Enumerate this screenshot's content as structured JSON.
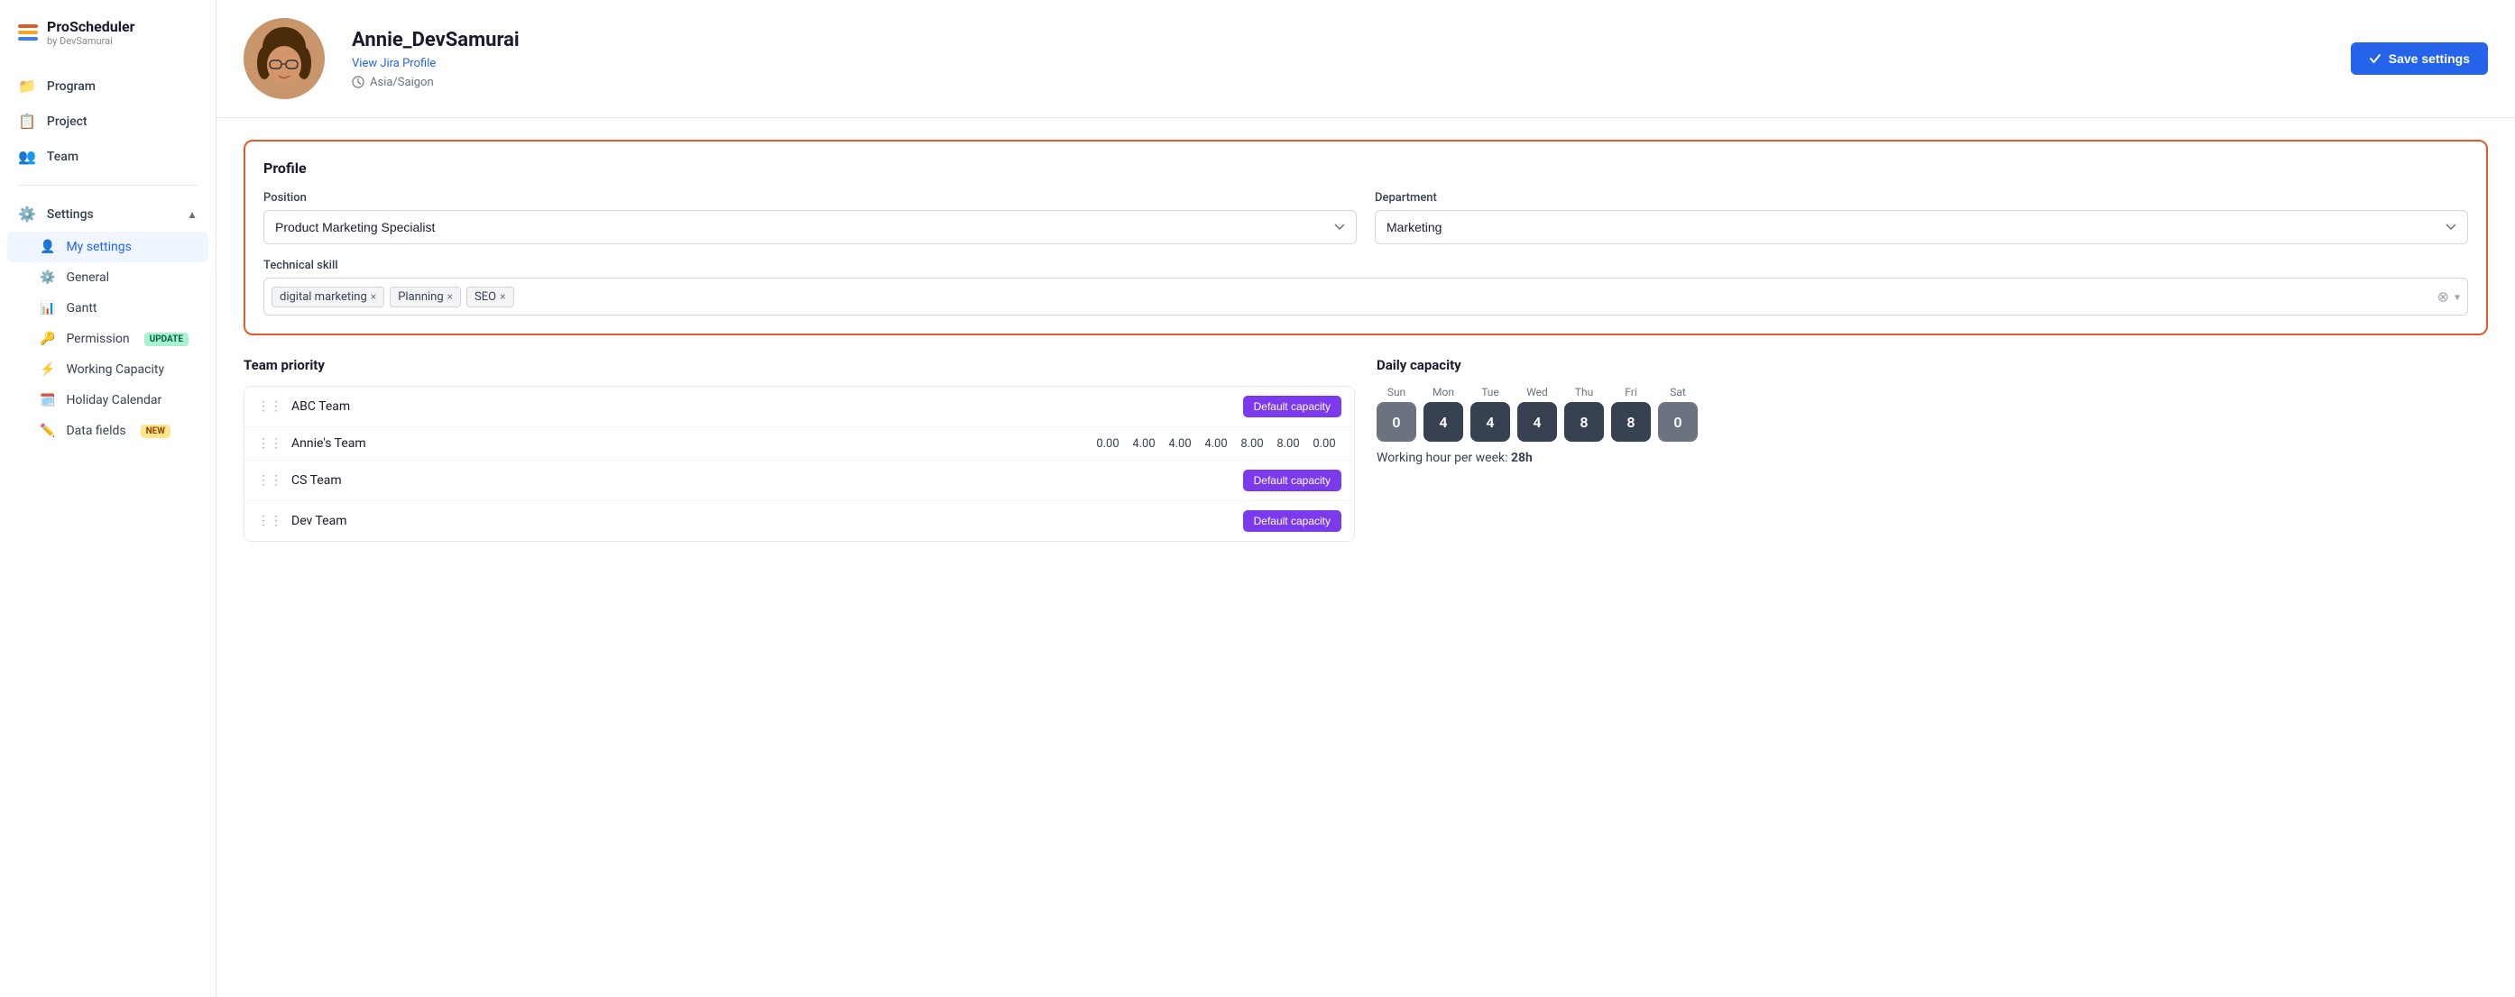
{
  "app": {
    "name": "ProScheduler",
    "byline": "by DevSamurai"
  },
  "nav": {
    "items": [
      {
        "id": "program",
        "label": "Program",
        "icon": "📁"
      },
      {
        "id": "project",
        "label": "Project",
        "icon": "📋"
      },
      {
        "id": "team",
        "label": "Team",
        "icon": "👥"
      }
    ],
    "settings_label": "Settings",
    "settings_expand": "▲",
    "sub_items": [
      {
        "id": "my-settings",
        "label": "My settings",
        "active": true,
        "badge": null,
        "icon": "👤"
      },
      {
        "id": "general",
        "label": "General",
        "active": false,
        "badge": null,
        "icon": "⚙️"
      },
      {
        "id": "gantt",
        "label": "Gantt",
        "active": false,
        "badge": null,
        "icon": "📊"
      },
      {
        "id": "permission",
        "label": "Permission",
        "active": false,
        "badge": "UPDATE",
        "badge_type": "update",
        "icon": "🔑"
      },
      {
        "id": "working-capacity",
        "label": "Working Capacity",
        "active": false,
        "badge": null,
        "icon": "⚡"
      },
      {
        "id": "holiday-calendar",
        "label": "Holiday Calendar",
        "active": false,
        "badge": null,
        "icon": "🗓️"
      },
      {
        "id": "data-fields",
        "label": "Data fields",
        "active": false,
        "badge": "NEW",
        "badge_type": "new",
        "icon": "✏️"
      }
    ]
  },
  "header": {
    "username": "Annie_DevSamurai",
    "jira_link": "View Jira Profile",
    "timezone": "Asia/Saigon",
    "save_button": "Save settings"
  },
  "profile": {
    "section_title": "Profile",
    "position_label": "Position",
    "position_value": "Product Marketing Specialist",
    "department_label": "Department",
    "department_value": "Marketing",
    "skills_label": "Technical skill",
    "skills": [
      {
        "label": "digital marketing"
      },
      {
        "label": "Planning"
      },
      {
        "label": "SEO"
      }
    ]
  },
  "team_priority": {
    "title": "Team priority",
    "teams": [
      {
        "name": "ABC Team",
        "type": "default",
        "values": null
      },
      {
        "name": "Annie's Team",
        "type": "custom",
        "values": [
          "0.00",
          "4.00",
          "4.00",
          "4.00",
          "8.00",
          "8.00",
          "0.00"
        ]
      },
      {
        "name": "CS Team",
        "type": "default",
        "values": null
      },
      {
        "name": "Dev Team",
        "type": "default",
        "values": null
      }
    ],
    "default_label": "Default capacity"
  },
  "daily_capacity": {
    "title": "Daily capacity",
    "days": [
      {
        "label": "Sun",
        "value": "0",
        "zero": true
      },
      {
        "label": "Mon",
        "value": "4",
        "zero": false
      },
      {
        "label": "Tue",
        "value": "4",
        "zero": false
      },
      {
        "label": "Wed",
        "value": "4",
        "zero": false
      },
      {
        "label": "Thu",
        "value": "8",
        "zero": false
      },
      {
        "label": "Fri",
        "value": "8",
        "zero": false
      },
      {
        "label": "Sat",
        "value": "0",
        "zero": true
      }
    ],
    "working_hours_label": "Working hour per week:",
    "working_hours_value": "28h"
  }
}
